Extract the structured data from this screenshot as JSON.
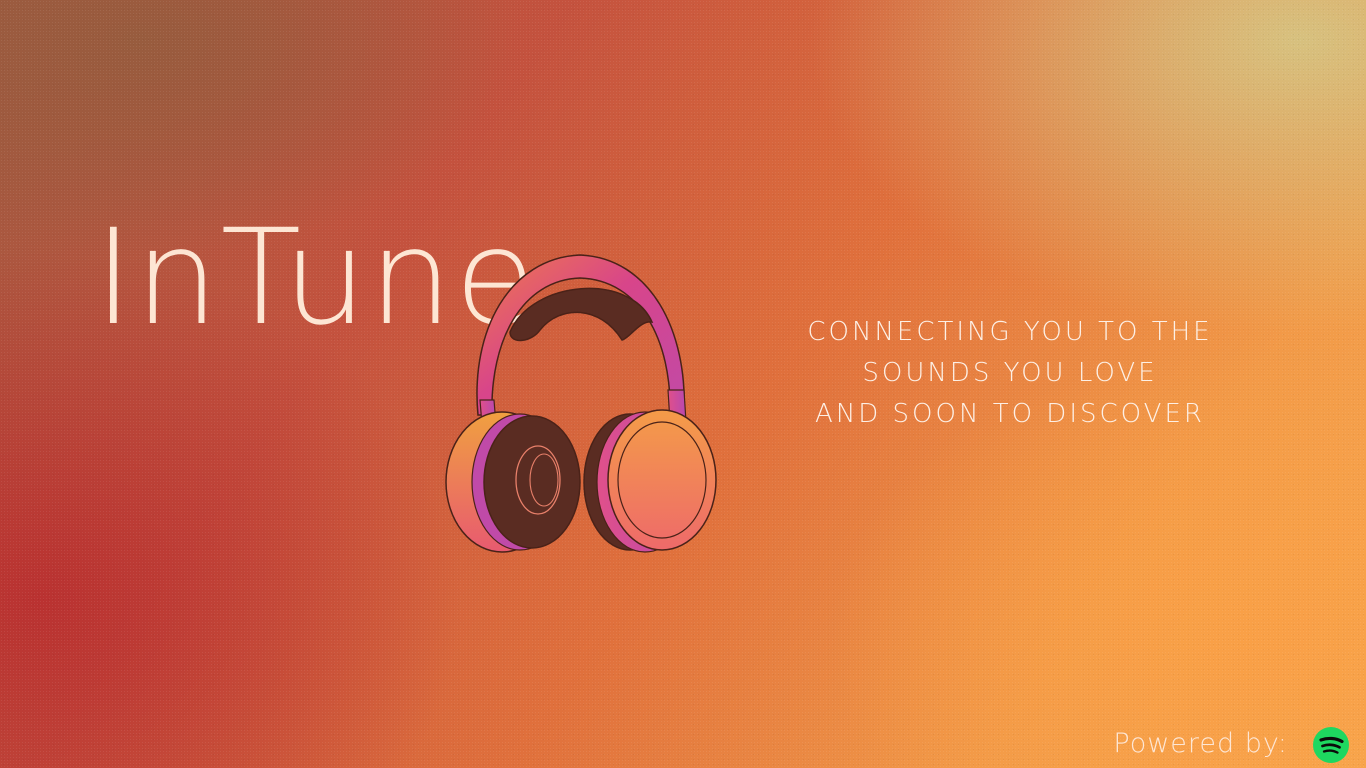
{
  "brand": {
    "title": "InTune"
  },
  "tagline": {
    "lines": [
      "CONNECTING YOU TO THE",
      "SOUNDS YOU LOVE",
      "AND SOON TO DISCOVER"
    ]
  },
  "footer": {
    "powered_by": "Powered by:",
    "logo_icon": "spotify-logo-icon"
  },
  "illustration": {
    "icon": "headphones-icon"
  },
  "colors": {
    "title_text": "#fde6d4",
    "tagline_text": "#fdf0e6",
    "spotify_green": "#1ed760",
    "headphone_pink": "#d8458a",
    "headphone_orange": "#f07a4a",
    "headphone_pad": "#5a2c22"
  }
}
